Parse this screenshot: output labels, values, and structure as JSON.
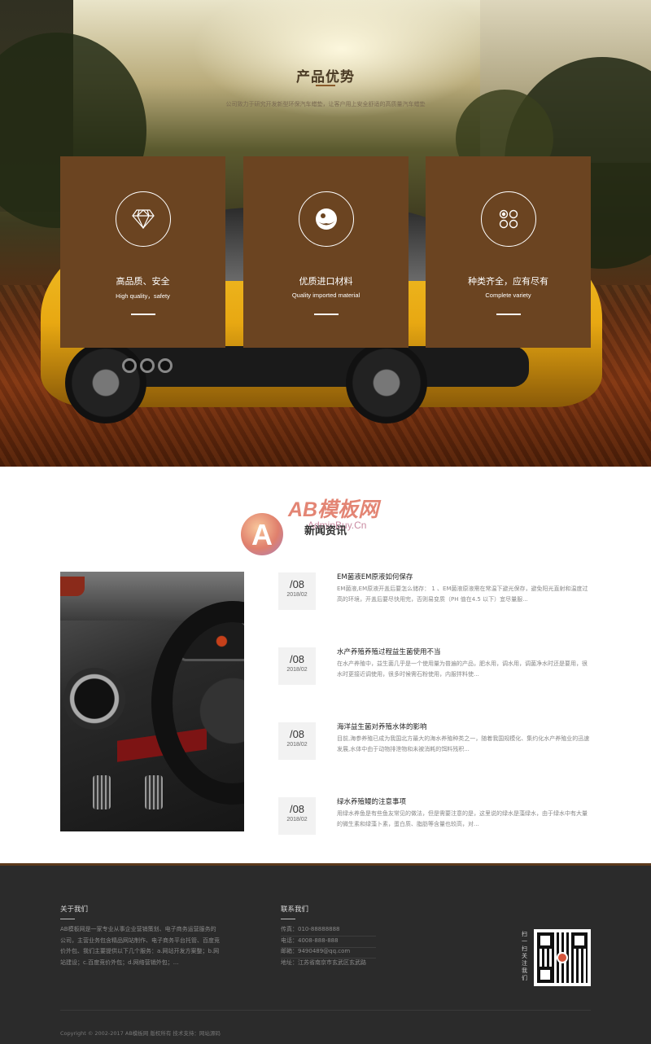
{
  "advantages": {
    "title": "产品优势",
    "subtitle": "公司致力于研究开发新型环保汽车蜡垫，让客户用上安全舒适的高质量汽车蜡垫",
    "cards": [
      {
        "title": "高品质、安全",
        "subtitle": "High quality，safety",
        "icon": "diamond-icon"
      },
      {
        "title": "优质进口材料",
        "subtitle": "Quality imported material",
        "icon": "sphere-icon"
      },
      {
        "title": "种类齐全，应有尽有",
        "subtitle": "Complete variety",
        "icon": "grid-icon"
      }
    ]
  },
  "news": {
    "heading": "新闻资讯",
    "watermark": {
      "big": "AB模板网",
      "small": "AdminBuy.Cn"
    },
    "items": [
      {
        "day": "/08",
        "ym": "2018/02",
        "title": "EM菌液EM原液如何保存",
        "desc": "EM菌液,EM原液开盖后要怎么储存： 1 、EM菌液原液需在常温下避光保存，避免阳光直射和温度过高的环境，开盖后要尽快用完，否则易变质（PH 值在4.5 以下）宜尽量服..."
      },
      {
        "day": "/08",
        "ym": "2018/02",
        "title": "水产养殖养殖过程益生菌使用不当",
        "desc": "在水产养殖中，益生菌几乎是一个使用量为普遍的产品，肥水用，调水用，调菌净水时还是要用，很水时更接近调使用，很多时候需石粉使用，内服拌料使..."
      },
      {
        "day": "/08",
        "ym": "2018/02",
        "title": "海洋益生菌对养殖水体的影响",
        "desc": "目前,海参养殖已成为我国北方最大的海水养殖种类之一，随着我国规模化、集约化水产养殖业的迅速发展,水体中由于动物排泄物和未被消耗的饵料残积..."
      },
      {
        "day": "/08",
        "ym": "2018/02",
        "title": "绿水养殖鳗的注意事项",
        "desc": "用绿水养鱼是有些鱼友常见的做法，但是需要注意的是，这里说的绿水是藻绿水，由于绿水中有大量的微生素和绿藻卜素，蛋白质、脂肪等含量也较高，对..."
      }
    ]
  },
  "footer": {
    "about_title": "关于我们",
    "about_text": "AB模板网是一家专业从事企业营销策划、电子商务运营服务的公司，主营业务包含精品网站制作、电子商务平台托管、百度竞价外包、我们主要提供以下几个服务：a.网站开发方案整；b.网站建设；c.百度竞价外包；d.网络营销外包；...",
    "contact_title": "联系我们",
    "contact_lines": [
      "传真：010-88888888",
      "电话：4008-888-888",
      "邮箱：9490489@qq.com",
      "地址：江苏省南京市玄武区玄武路"
    ],
    "qr_label": "扫一扫关注我们",
    "copyright": "Copyright © 2002-2017 AB模板网 版权所有    技术支持：网站源码"
  },
  "colors": {
    "card_brown": "#6b4421",
    "footer_bg": "#2b2b2b"
  }
}
